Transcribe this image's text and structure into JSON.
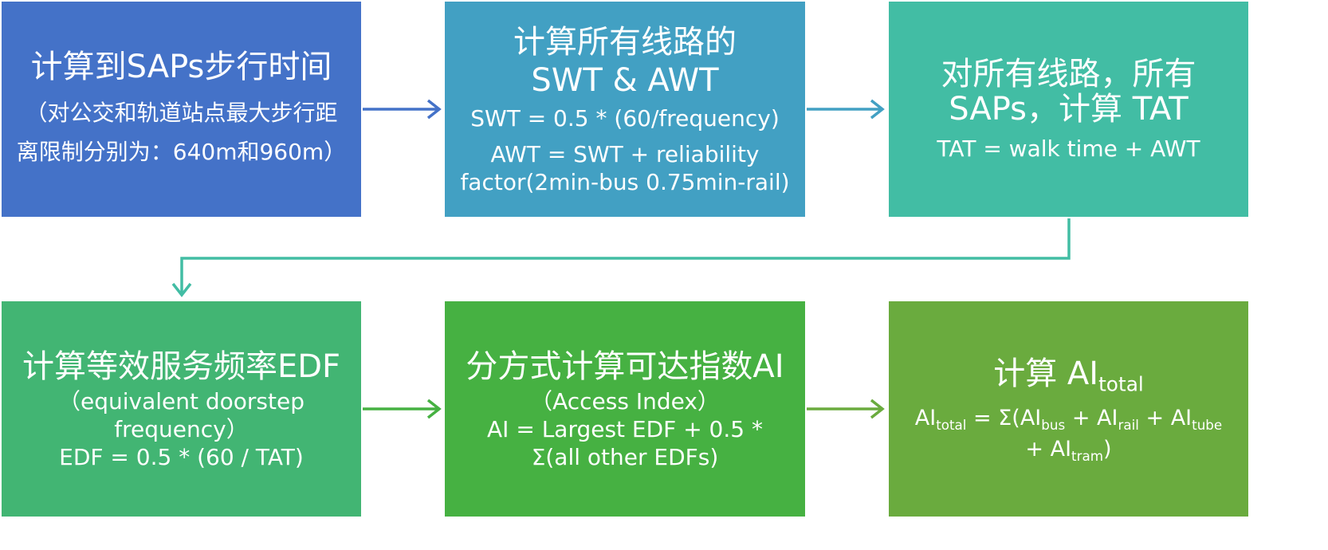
{
  "colors": {
    "box1": "#4472c8",
    "box2": "#42a0c3",
    "box3": "#42bda4",
    "box4": "#42b573",
    "box5": "#46b142",
    "box6": "#6aab3e",
    "arrow1": "#4472c8",
    "arrow2": "#42a0c3",
    "connector": "#42bda4",
    "arrow4": "#46b142",
    "arrow5": "#6aab3e"
  },
  "box1": {
    "title": "计算到SAPs步行时间",
    "line1": "（对公交和轨道站点最大步行距",
    "line2": "离限制分别为：640m和960m）"
  },
  "box2": {
    "title1": "计算所有线路的",
    "title2": "SWT & AWT",
    "line1": "SWT = 0.5 * (60/frequency)",
    "line2": "AWT = SWT + reliability",
    "line3": "factor(2min-bus  0.75min-rail)"
  },
  "box3": {
    "title1": "对所有线路，所有",
    "title2": "SAPs，计算 TAT",
    "line1": "TAT = walk time + AWT"
  },
  "box4": {
    "title": "计算等效服务频率EDF",
    "line1": "（equivalent  doorstep",
    "line2": "frequency）",
    "line3": "EDF = 0.5 * (60 / TAT)"
  },
  "box5": {
    "title": "分方式计算可达指数AI",
    "line1": "（Access Index）",
    "line2": "AI = Largest EDF + 0.5 *",
    "line3": "Σ(all other EDFs)"
  },
  "box6": {
    "title_main": "计算 AI",
    "title_sub": "total",
    "f_ai": "AI",
    "f_total": "total",
    "f_eq": " = Σ(AI",
    "f_bus": "bus",
    "f_plus1": " + AI",
    "f_rail": "rail",
    "f_plus2": " + AI",
    "f_tube": "tube",
    "f_plus3": "+ AI",
    "f_tram": "tram",
    "f_close": ")"
  }
}
